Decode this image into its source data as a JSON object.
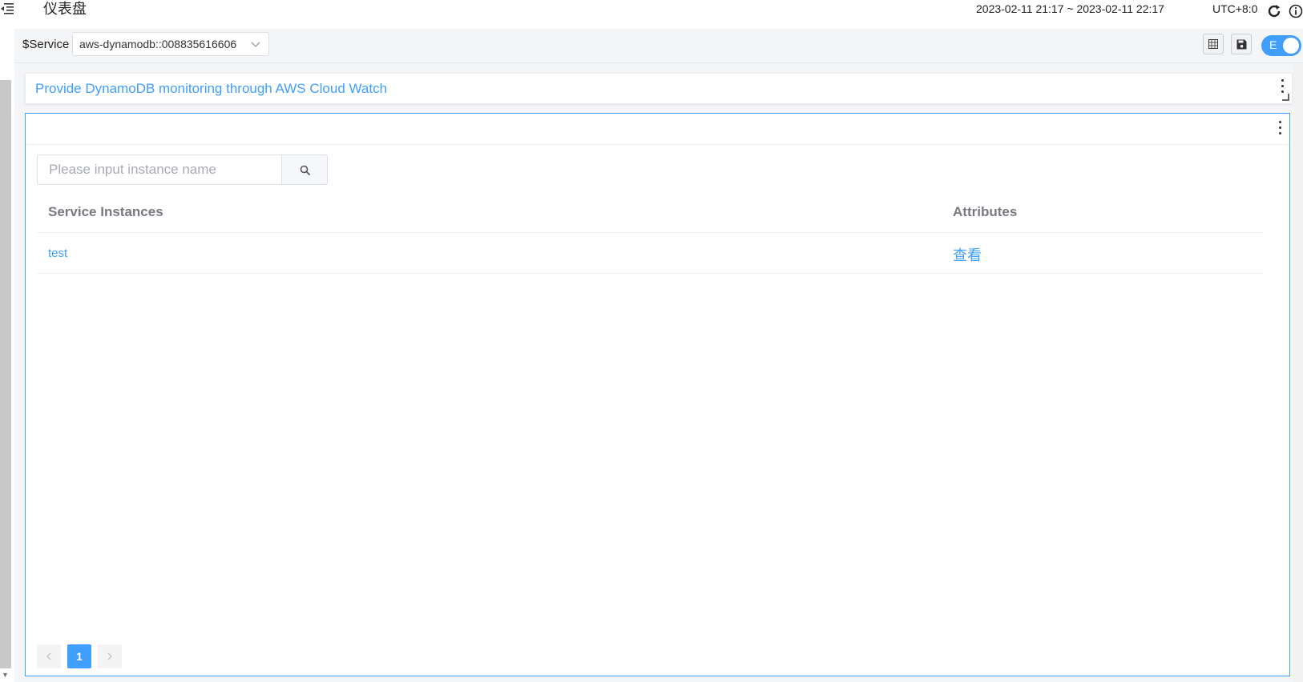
{
  "header": {
    "title": "仪表盘",
    "time_range": "2023-02-11 21:17 ~ 2023-02-11 22:17",
    "timezone": "UTC+8:0"
  },
  "variables": {
    "service_label": "$Service",
    "service_value": "aws-dynamodb::008835616606"
  },
  "toolbar": {
    "toggle_label": "E",
    "accent_color": "#409eff"
  },
  "text_widget": {
    "content": "Provide DynamoDB monitoring through AWS Cloud Watch"
  },
  "instance_widget": {
    "search": {
      "placeholder": "Please input instance name",
      "value": ""
    },
    "table": {
      "columns": [
        "Service Instances",
        "Attributes"
      ],
      "rows": [
        {
          "instance": "test",
          "attributes": "查看"
        }
      ]
    },
    "pagination": {
      "current_page": "1",
      "prev_icon": "chevron-left-icon",
      "next_icon": "chevron-right-icon"
    }
  },
  "icons": {
    "menu": "menu-fold-icon",
    "refresh": "refresh-icon",
    "info": "info-icon",
    "layout": "grid-icon",
    "save": "save-icon",
    "search": "search-icon",
    "more": "more-vertical-icon"
  }
}
